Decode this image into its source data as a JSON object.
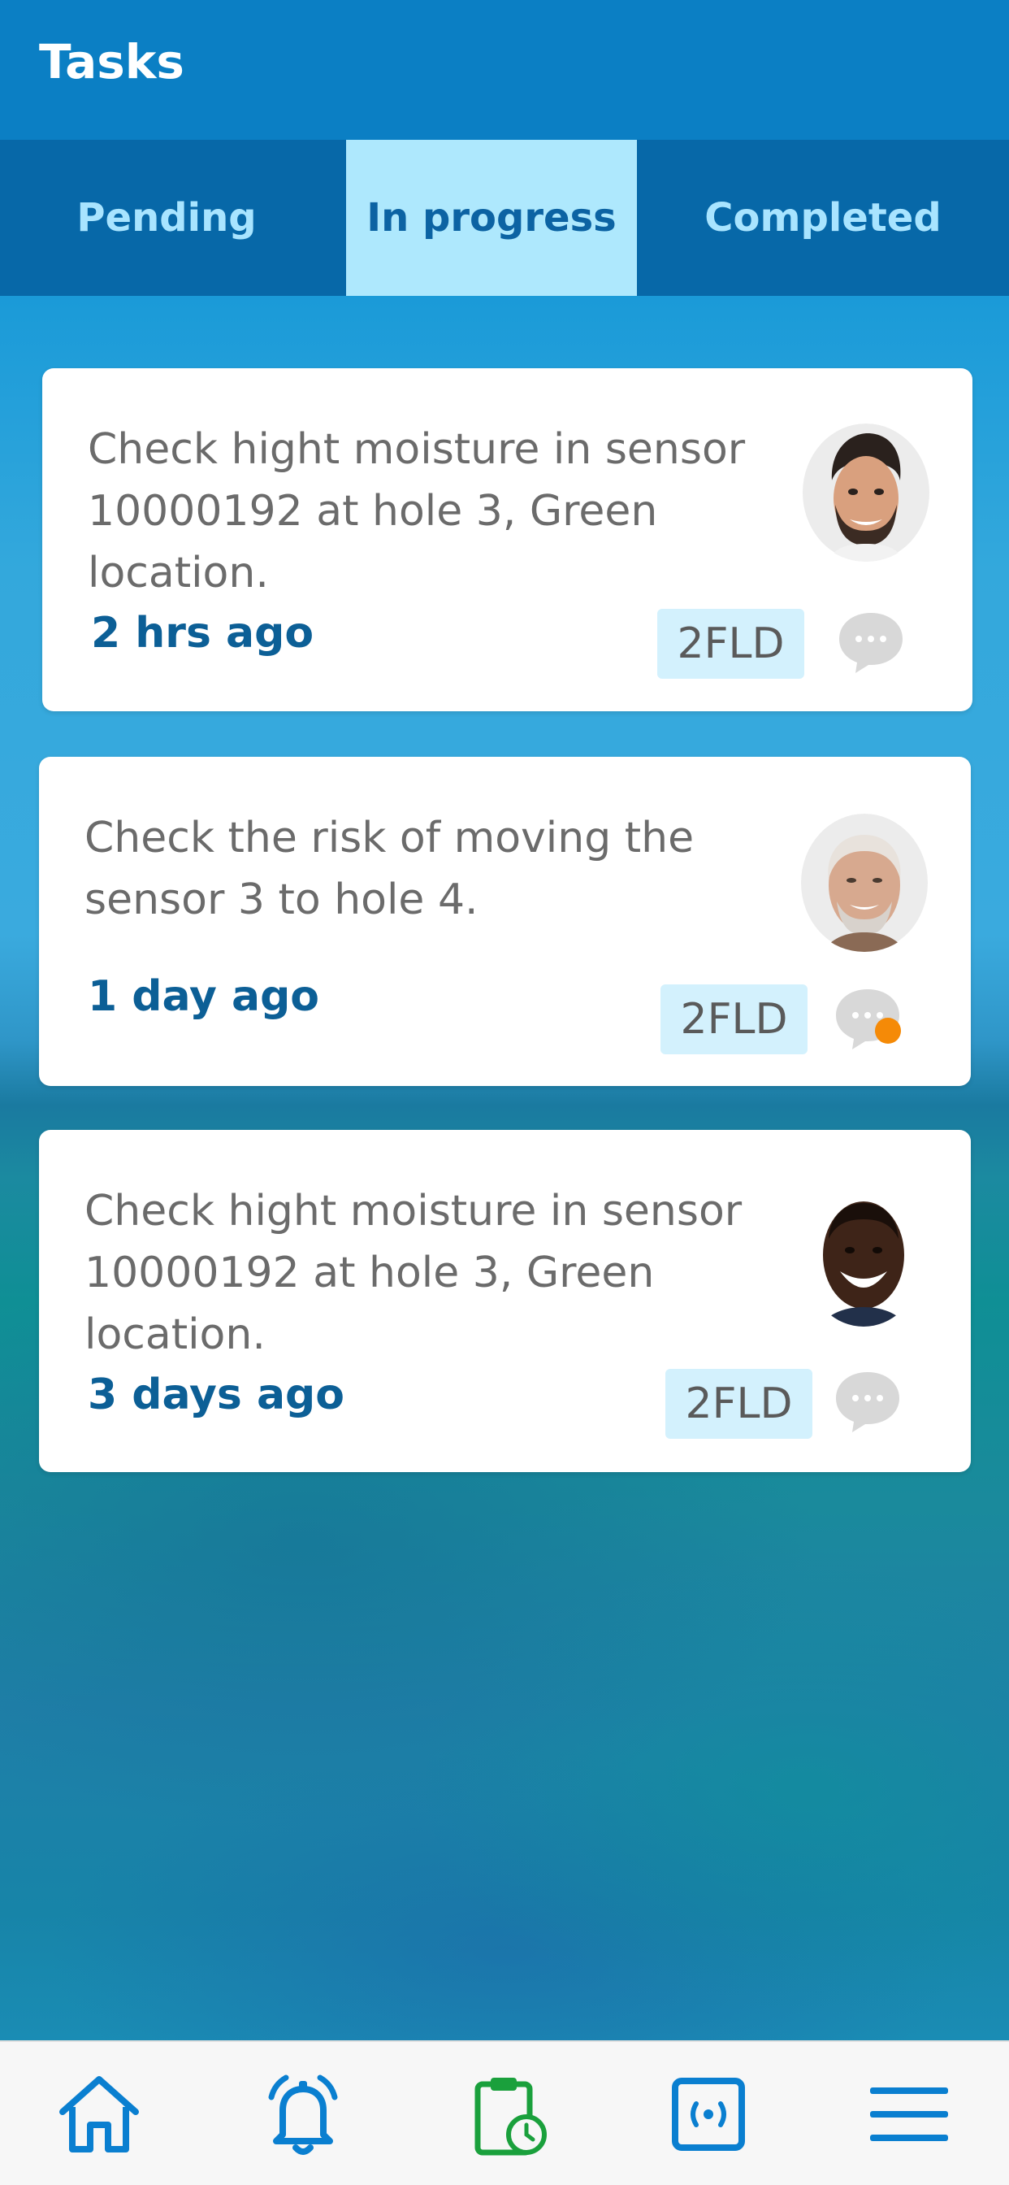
{
  "header": {
    "title": "Tasks"
  },
  "tabs": [
    {
      "label": "Pending",
      "active": false
    },
    {
      "label": "In progress",
      "active": true
    },
    {
      "label": "Completed",
      "active": false
    }
  ],
  "tasks": [
    {
      "text": "Check hight moisture in sensor 10000192 at hole 3, Green location.",
      "time": "2 hrs ago",
      "badge": "2FLD",
      "unread": false
    },
    {
      "text": "Check the risk of moving the sensor 3 to hole 4.",
      "time": "1 day ago",
      "badge": "2FLD",
      "unread": true
    },
    {
      "text": "Check hight moisture in sensor 10000192 at hole 3, Green location.",
      "time": "3 days ago",
      "badge": "2FLD",
      "unread": false
    }
  ],
  "nav": [
    {
      "icon": "home-icon",
      "color": "#0a7fd0"
    },
    {
      "icon": "bell-icon",
      "color": "#0a7fd0"
    },
    {
      "icon": "clipboard-clock-icon",
      "color": "#1aa03c",
      "active": true
    },
    {
      "icon": "sensor-icon",
      "color": "#0a7fd0"
    },
    {
      "icon": "menu-icon",
      "color": "#0a7fd0"
    }
  ],
  "colors": {
    "header": "#0b7fc4",
    "tab_bar": "#0768a8",
    "active_tab": "#aee8fd",
    "time_text": "#0c5f96",
    "badge_bg": "#d3f1fd",
    "unread_dot": "#f58a07"
  }
}
